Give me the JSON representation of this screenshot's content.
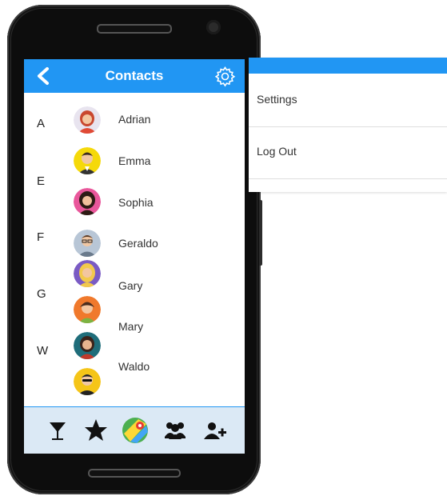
{
  "header": {
    "title": "Contacts"
  },
  "sections": [
    {
      "letter": "A"
    },
    {
      "letter": "E"
    },
    {
      "letter": "F"
    },
    {
      "letter": "G"
    },
    {
      "letter": "W"
    }
  ],
  "contacts": [
    {
      "name": "Adrian"
    },
    {
      "name": "Emma"
    },
    {
      "name": "Sophia"
    },
    {
      "name": "Geraldo"
    },
    {
      "name": "Gary"
    },
    {
      "name": "Mary"
    },
    {
      "name": "Waldo"
    }
  ],
  "tabs": [
    {
      "icon": "cocktail-glass-icon"
    },
    {
      "icon": "star-icon"
    },
    {
      "icon": "map-icon"
    },
    {
      "icon": "group-icon"
    },
    {
      "icon": "add-user-icon"
    }
  ],
  "menu": {
    "items": [
      {
        "label": "Settings"
      },
      {
        "label": "Log Out"
      }
    ]
  },
  "colors": {
    "accent": "#2196f3",
    "bottom_bar": "#dbe9f5",
    "phone": "#0d0d0d"
  }
}
